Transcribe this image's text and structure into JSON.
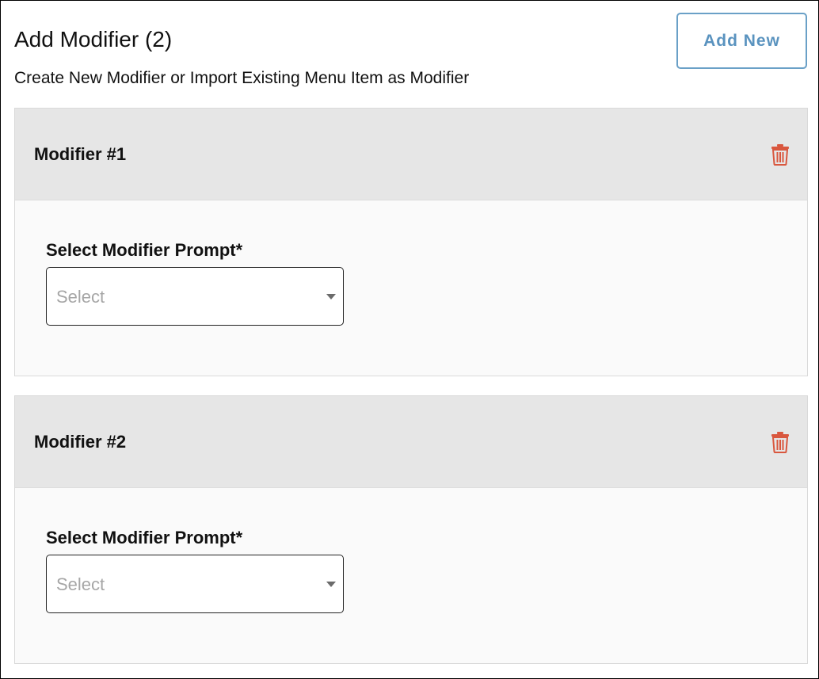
{
  "header": {
    "title": "Add Modifier (2)",
    "subtitle": "Create New Modifier or Import Existing Menu Item as Modifier",
    "add_new_label": "Add New"
  },
  "colors": {
    "accent": "#5a93bf",
    "delete": "#d9573e",
    "card_header_bg": "#e6e6e6",
    "card_body_bg": "#fafafa"
  },
  "modifiers": [
    {
      "title": "Modifier #1",
      "field_label": "Select Modifier Prompt*",
      "select_placeholder": "Select",
      "delete_icon": "trash-icon"
    },
    {
      "title": "Modifier #2",
      "field_label": "Select Modifier Prompt*",
      "select_placeholder": "Select",
      "delete_icon": "trash-icon"
    }
  ]
}
